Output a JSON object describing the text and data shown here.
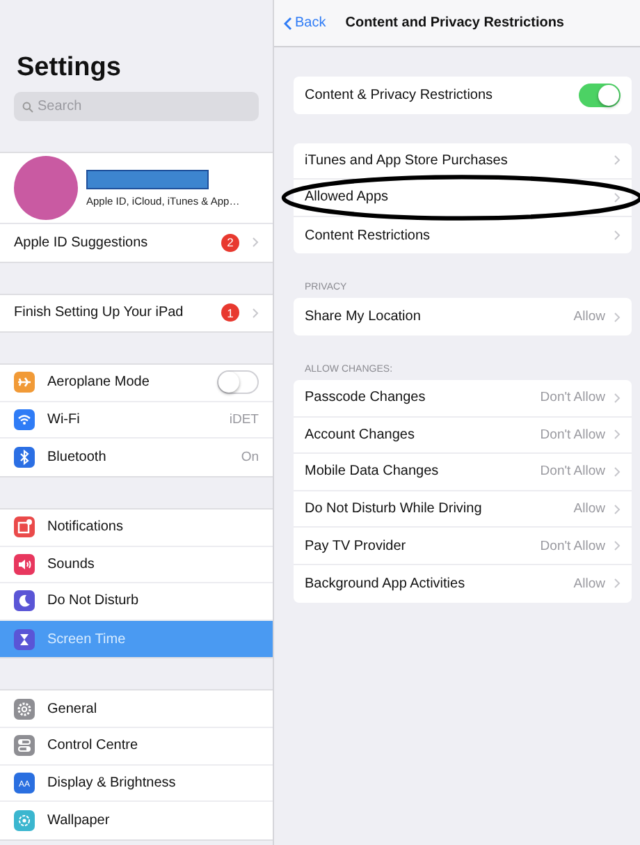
{
  "sidebar": {
    "title": "Settings",
    "search": {
      "placeholder": "Search"
    },
    "groups": [
      {
        "items": [
          {
            "kind": "profile",
            "subtitle": "Apple ID, iCloud, iTunes & App…"
          },
          {
            "kind": "row",
            "label": "Apple ID Suggestions",
            "badge": "2",
            "selected": false
          }
        ]
      },
      {
        "items": [
          {
            "kind": "row",
            "label": "Finish Setting Up Your iPad",
            "badge": "1",
            "selected": false
          }
        ]
      },
      {
        "items": [
          {
            "kind": "toggle",
            "label": "Aeroplane Mode",
            "on": false,
            "selected": false
          },
          {
            "kind": "row",
            "label": "Wi-Fi",
            "value": "iDET",
            "selected": false
          },
          {
            "kind": "row",
            "label": "Bluetooth",
            "value": "On",
            "selected": false
          }
        ]
      },
      {
        "items": [
          {
            "kind": "row",
            "label": "Notifications",
            "selected": false
          },
          {
            "kind": "row",
            "label": "Sounds",
            "selected": false
          },
          {
            "kind": "row",
            "label": "Do Not Disturb",
            "selected": false
          },
          {
            "kind": "row",
            "label": "Screen Time",
            "selected": true
          }
        ]
      },
      {
        "items": [
          {
            "kind": "row",
            "label": "General",
            "selected": false
          },
          {
            "kind": "row",
            "label": "Control Centre",
            "selected": false
          },
          {
            "kind": "row",
            "glyph": "AA",
            "label": "Display & Brightness",
            "selected": false
          },
          {
            "kind": "row",
            "label": "Wallpaper",
            "selected": false
          }
        ]
      }
    ]
  },
  "nav": {
    "back": "Back",
    "title": "Content and Privacy Restrictions"
  },
  "sections": [
    {
      "rows": [
        {
          "kind": "toggle",
          "label": "Content & Privacy Restrictions",
          "on": true
        }
      ]
    },
    {
      "rows": [
        {
          "kind": "link",
          "label": "iTunes and App Store Purchases",
          "circled": false
        },
        {
          "kind": "link",
          "label": "Allowed Apps",
          "circled": true
        },
        {
          "kind": "link",
          "label": "Content Restrictions",
          "circled": false
        }
      ]
    },
    {
      "header": "PRIVACY",
      "rows": [
        {
          "kind": "link",
          "label": "Share My Location",
          "value": "Allow",
          "circled": false
        }
      ]
    },
    {
      "header": "ALLOW CHANGES:",
      "rows": [
        {
          "kind": "link",
          "label": "Passcode Changes",
          "value": "Don't Allow",
          "circled": false
        },
        {
          "kind": "link",
          "label": "Account Changes",
          "value": "Don't Allow",
          "circled": false
        },
        {
          "kind": "link",
          "label": "Mobile Data Changes",
          "value": "Don't Allow",
          "circled": false
        },
        {
          "kind": "link",
          "label": "Do Not Disturb While Driving",
          "value": "Allow",
          "circled": false
        },
        {
          "kind": "link",
          "label": "Pay TV Provider",
          "value": "Don't Allow",
          "circled": false
        },
        {
          "kind": "link",
          "label": "Background App Activities",
          "value": "Allow",
          "circled": false
        }
      ]
    }
  ]
}
